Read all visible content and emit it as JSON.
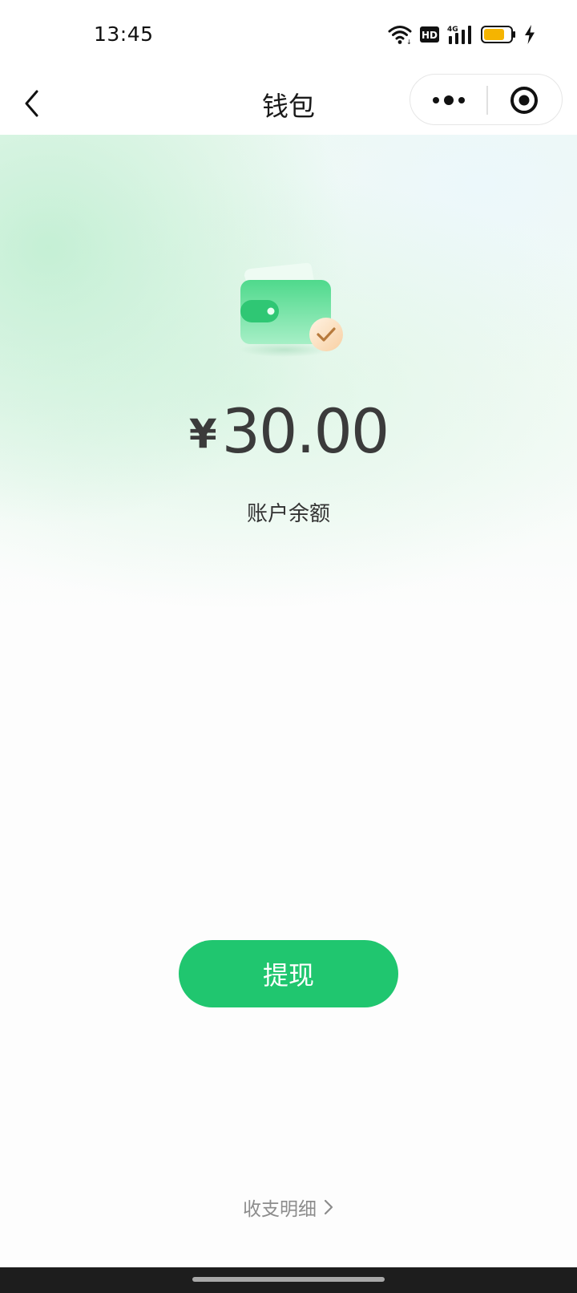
{
  "status_bar": {
    "time": "13:45",
    "network_badge": "HD",
    "signal_label": "4G",
    "icons": [
      "wifi-icon",
      "hd-icon",
      "signal-4g-icon",
      "battery-icon",
      "charging-icon"
    ],
    "battery_color": "#f5b400"
  },
  "nav": {
    "title": "钱包",
    "back_icon": "chevron-left-icon",
    "more_icon": "more-dots-icon",
    "close_icon": "target-circle-icon"
  },
  "wallet": {
    "currency_symbol": "¥",
    "amount": "30.00",
    "balance_label": "账户余额",
    "icon": "wallet-check-icon"
  },
  "actions": {
    "withdraw_label": "提现",
    "details_label": "收支明细",
    "details_icon": "chevron-right-icon"
  },
  "colors": {
    "accent": "#20c66f",
    "text_primary": "#1a1a1a",
    "text_secondary": "#8c8c8c"
  }
}
